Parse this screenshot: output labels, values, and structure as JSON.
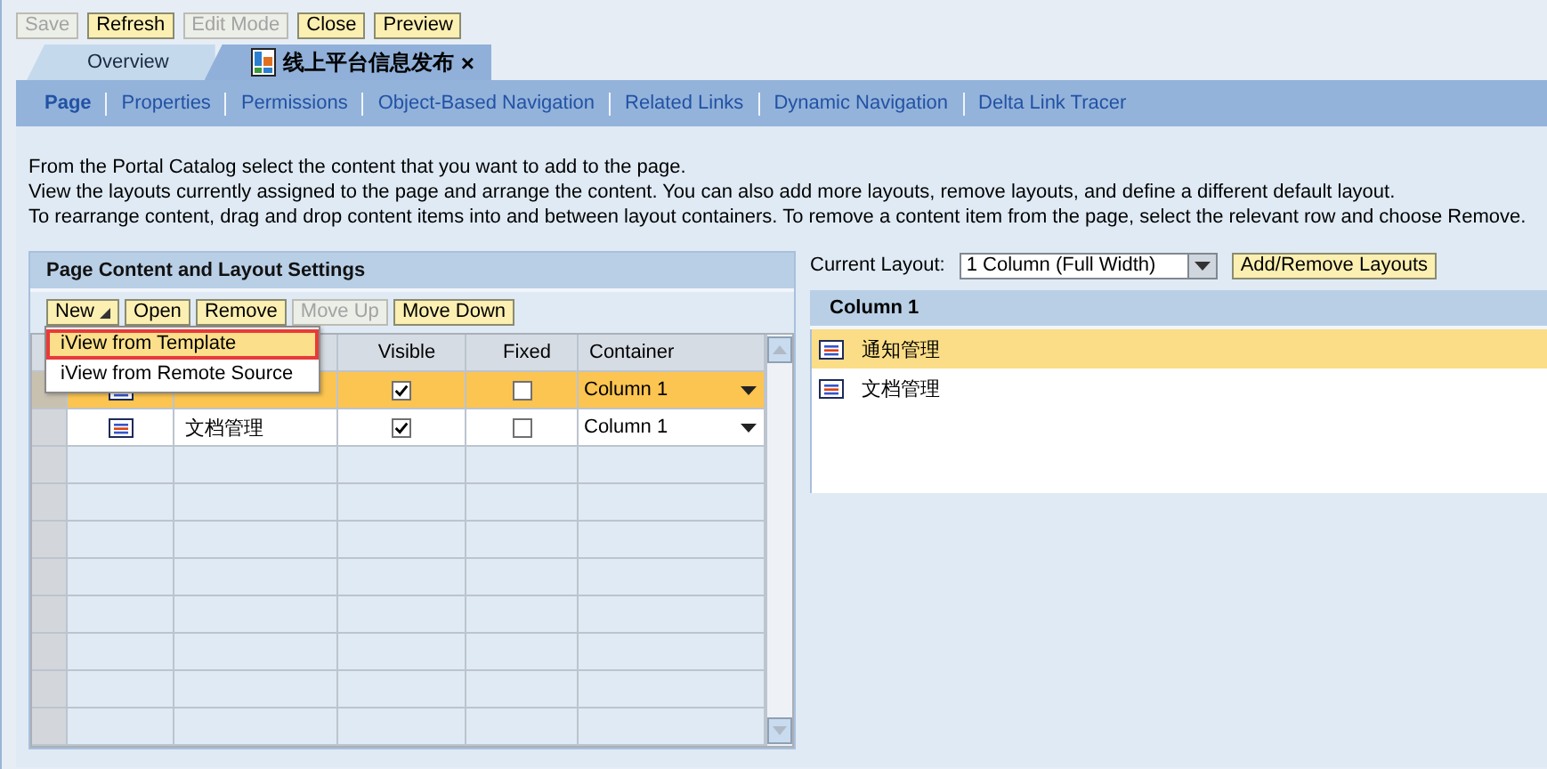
{
  "toolbar": [
    {
      "label": "Save",
      "disabled": true
    },
    {
      "label": "Refresh",
      "disabled": false
    },
    {
      "label": "Edit Mode",
      "disabled": true
    },
    {
      "label": "Close",
      "disabled": false
    },
    {
      "label": "Preview",
      "disabled": false
    }
  ],
  "editor_tabs": [
    {
      "label": "Overview",
      "selected": false
    },
    {
      "label": "线上平台信息发布",
      "selected": true,
      "close": "×"
    }
  ],
  "nav_tabs": [
    {
      "label": "Page",
      "selected": true
    },
    {
      "label": "Properties",
      "selected": false
    },
    {
      "label": "Permissions",
      "selected": false
    },
    {
      "label": "Object-Based Navigation",
      "selected": false
    },
    {
      "label": "Related Links",
      "selected": false
    },
    {
      "label": "Dynamic Navigation",
      "selected": false
    },
    {
      "label": "Delta Link Tracer",
      "selected": false
    }
  ],
  "instructions": [
    "From the Portal Catalog select the content that you want to add to the page.",
    "View the layouts currently assigned to the page and arrange the content. You can also add more layouts, remove layouts, and define a different default layout.",
    "To rearrange content, drag and drop content items into and between layout containers. To remove a content item from the page, select the relevant row and choose Remove."
  ],
  "content_panel": {
    "title": "Page Content and Layout Settings",
    "buttons": [
      {
        "label": "New",
        "kind": "menu",
        "disabled": false
      },
      {
        "label": "Open",
        "kind": "plain",
        "disabled": false
      },
      {
        "label": "Remove",
        "kind": "plain",
        "disabled": false
      },
      {
        "label": "Move Up",
        "kind": "plain",
        "disabled": true
      },
      {
        "label": "Move Down",
        "kind": "plain",
        "disabled": false
      }
    ],
    "menu": [
      {
        "label": "iView from Template",
        "selected": true
      },
      {
        "label": "iView from Remote Source",
        "selected": false
      }
    ],
    "columns": [
      "Visible",
      "Fixed",
      "Container"
    ],
    "rows": [
      {
        "visible": true,
        "fixed": false,
        "container": "Column 1",
        "selected": true
      },
      {
        "name": "文档管理",
        "visible": true,
        "fixed": false,
        "container": "Column 1",
        "selected": false
      }
    ]
  },
  "layout_panel": {
    "label": "Current Layout:",
    "value": "1 Column (Full Width)",
    "button": "Add/Remove Layouts",
    "column_title": "Column 1",
    "items": [
      {
        "name": "通知管理",
        "selected": true
      },
      {
        "name": "文档管理",
        "selected": false
      }
    ]
  }
}
